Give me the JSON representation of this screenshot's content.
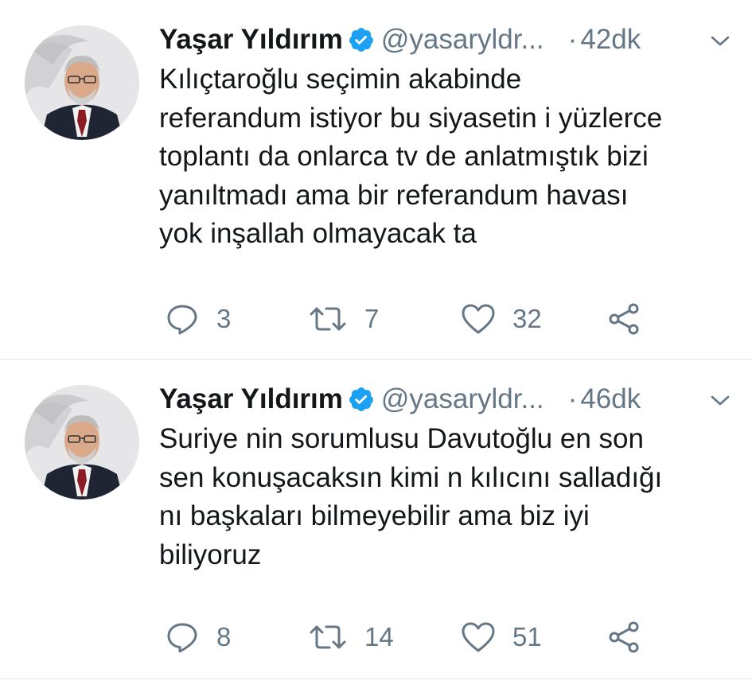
{
  "tweets": [
    {
      "name": "Yaşar Yıldırım",
      "handle": "@yasaryldr...",
      "dot": "·",
      "time": "42dk",
      "text_lines": [
        "Kılıçtaroğlu seçimin akabinde",
        "referandum istiyor bu siyasetin i yüzlerce",
        "toplantı da onlarca tv de anlatmıştık bizi",
        "yanıltmadı ama bir referandum havası",
        "yok inşallah olmayacak ta"
      ],
      "replies": "3",
      "retweets": "7",
      "likes": "32"
    },
    {
      "name": "Yaşar Yıldırım",
      "handle": "@yasaryldr...",
      "dot": "·",
      "time": "46dk",
      "text_lines": [
        "Suriye nin sorumlusu Davutoğlu en son",
        "sen konuşacaksın kimi n kılıcını salladığı",
        "nı başkaları bilmeyebilir ama biz iyi",
        "biliyoruz"
      ],
      "replies": "8",
      "retweets": "14",
      "likes": "51"
    }
  ],
  "icons": {
    "verified": "verified-badge-icon",
    "chevron": "chevron-down-icon",
    "reply": "reply-icon",
    "retweet": "retweet-icon",
    "like": "heart-icon",
    "share": "share-icon"
  },
  "colors": {
    "text": "#14171a",
    "secondary": "#657786",
    "verified": "#1da1f2",
    "divider": "#e1e8ed"
  }
}
